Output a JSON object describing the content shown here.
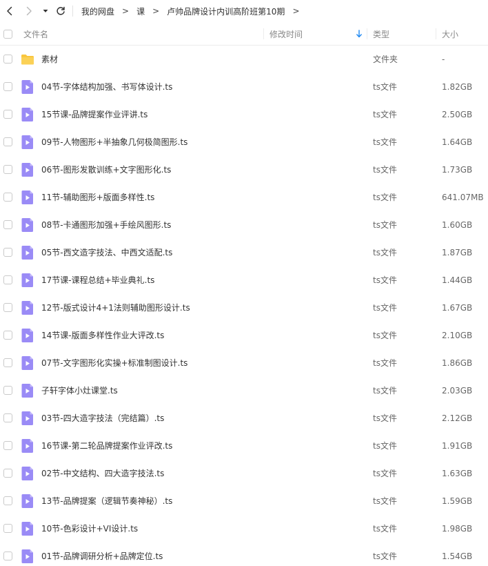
{
  "breadcrumb": [
    "我的网盘",
    "课",
    "卢帅品牌设计内训高阶班第10期"
  ],
  "breadcrumb_separator": ">",
  "columns": {
    "name": "文件名",
    "mtime": "修改时间",
    "type": "类型",
    "size": "大小"
  },
  "files": [
    {
      "name": "素材",
      "type": "文件夹",
      "size": "-",
      "icon": "folder-icon"
    },
    {
      "name": "04节-字体结构加强、书写体设计.ts",
      "type": "ts文件",
      "size": "1.82GB",
      "icon": "video-file-icon"
    },
    {
      "name": "15节课-品牌提案作业评讲.ts",
      "type": "ts文件",
      "size": "2.50GB",
      "icon": "video-file-icon"
    },
    {
      "name": "09节-人物图形+半抽象几何极简图形.ts",
      "type": "ts文件",
      "size": "1.64GB",
      "icon": "video-file-icon"
    },
    {
      "name": "06节-图形发散训练+文字图形化.ts",
      "type": "ts文件",
      "size": "1.73GB",
      "icon": "video-file-icon"
    },
    {
      "name": "11节-辅助图形+版面多样性.ts",
      "type": "ts文件",
      "size": "641.07MB",
      "icon": "video-file-icon"
    },
    {
      "name": "08节-卡通图形加强+手绘风图形.ts",
      "type": "ts文件",
      "size": "1.60GB",
      "icon": "video-file-icon"
    },
    {
      "name": "05节-西文造字技法、中西文适配.ts",
      "type": "ts文件",
      "size": "1.87GB",
      "icon": "video-file-icon"
    },
    {
      "name": "17节课-课程总结+毕业典礼.ts",
      "type": "ts文件",
      "size": "1.44GB",
      "icon": "video-file-icon"
    },
    {
      "name": "12节-版式设计4+1法则辅助图形设计.ts",
      "type": "ts文件",
      "size": "1.67GB",
      "icon": "video-file-icon"
    },
    {
      "name": "14节课-版面多样性作业大评改.ts",
      "type": "ts文件",
      "size": "2.10GB",
      "icon": "video-file-icon"
    },
    {
      "name": "07节-文字图形化实操+标准制图设计.ts",
      "type": "ts文件",
      "size": "1.86GB",
      "icon": "video-file-icon"
    },
    {
      "name": "子轩字体小灶课堂.ts",
      "type": "ts文件",
      "size": "2.03GB",
      "icon": "video-file-icon"
    },
    {
      "name": "03节-四大造字技法（完结篇）.ts",
      "type": "ts文件",
      "size": "2.12GB",
      "icon": "video-file-icon"
    },
    {
      "name": "16节课-第二轮品牌提案作业评改.ts",
      "type": "ts文件",
      "size": "1.91GB",
      "icon": "video-file-icon"
    },
    {
      "name": "02节-中文结构、四大造字技法.ts",
      "type": "ts文件",
      "size": "1.63GB",
      "icon": "video-file-icon"
    },
    {
      "name": "13节-品牌提案（逻辑节奏神秘）.ts",
      "type": "ts文件",
      "size": "1.59GB",
      "icon": "video-file-icon"
    },
    {
      "name": "10节-色彩设计+VI设计.ts",
      "type": "ts文件",
      "size": "1.98GB",
      "icon": "video-file-icon"
    },
    {
      "name": "01节-品牌调研分析+品牌定位.ts",
      "type": "ts文件",
      "size": "1.54GB",
      "icon": "video-file-icon"
    }
  ],
  "colors": {
    "folder": "#F9C63E",
    "video_icon": "#9A8BF6",
    "sort_arrow": "#1E88F2",
    "text": "#333333",
    "muted": "#888888"
  },
  "toolbar_icons": [
    "back-icon",
    "forward-icon",
    "dropdown-icon",
    "refresh-icon"
  ]
}
